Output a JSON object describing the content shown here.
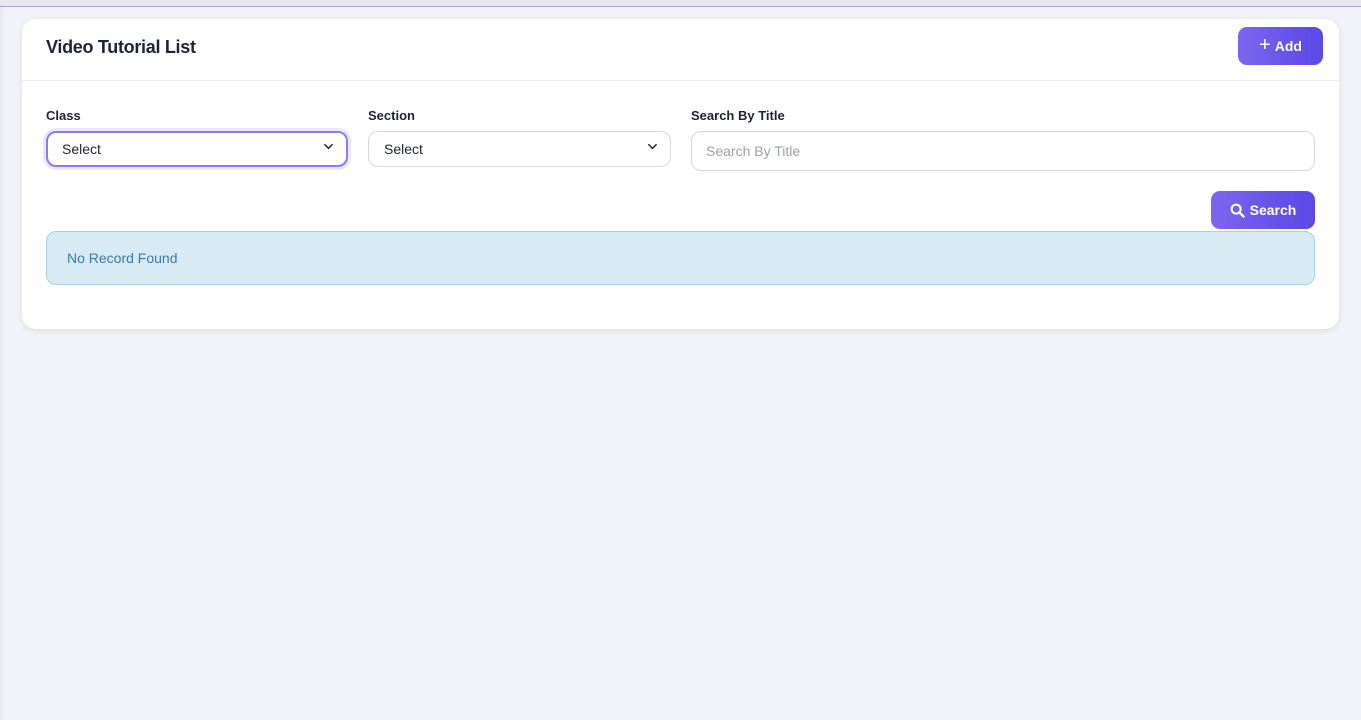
{
  "page": {
    "title": "Video Tutorial List",
    "add_label": "Add"
  },
  "filters": {
    "class": {
      "label": "Class",
      "selected": "Select"
    },
    "section": {
      "label": "Section",
      "selected": "Select"
    },
    "title_search": {
      "label": "Search By Title",
      "placeholder": "Search By Title",
      "value": ""
    },
    "search_label": "Search"
  },
  "results": {
    "empty_message": "No Record Found"
  },
  "icons": {
    "add": "plus-icon",
    "search": "search-icon",
    "dropdown": "chevron-down-icon"
  },
  "colors": {
    "accent": "#6c57ec",
    "alert_bg": "#d6ebf4",
    "alert_text": "#3b7bab"
  }
}
